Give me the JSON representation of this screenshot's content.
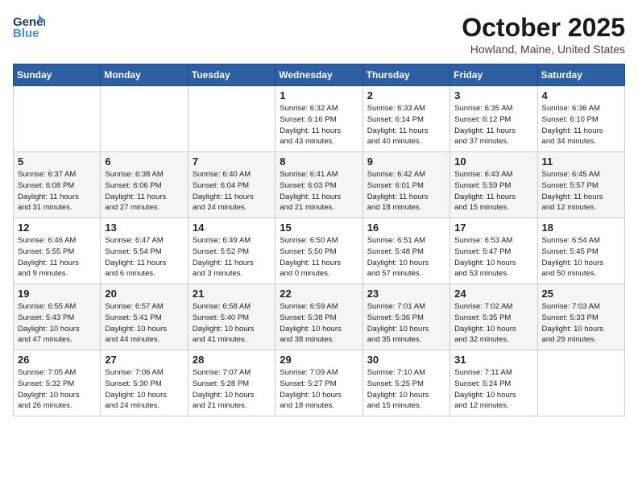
{
  "header": {
    "logo_line1": "General",
    "logo_line2": "Blue",
    "month": "October 2025",
    "location": "Howland, Maine, United States"
  },
  "days_of_week": [
    "Sunday",
    "Monday",
    "Tuesday",
    "Wednesday",
    "Thursday",
    "Friday",
    "Saturday"
  ],
  "weeks": [
    [
      {
        "day": "",
        "info": ""
      },
      {
        "day": "",
        "info": ""
      },
      {
        "day": "",
        "info": ""
      },
      {
        "day": "1",
        "info": "Sunrise: 6:32 AM\nSunset: 6:16 PM\nDaylight: 11 hours\nand 43 minutes."
      },
      {
        "day": "2",
        "info": "Sunrise: 6:33 AM\nSunset: 6:14 PM\nDaylight: 11 hours\nand 40 minutes."
      },
      {
        "day": "3",
        "info": "Sunrise: 6:35 AM\nSunset: 6:12 PM\nDaylight: 11 hours\nand 37 minutes."
      },
      {
        "day": "4",
        "info": "Sunrise: 6:36 AM\nSunset: 6:10 PM\nDaylight: 11 hours\nand 34 minutes."
      }
    ],
    [
      {
        "day": "5",
        "info": "Sunrise: 6:37 AM\nSunset: 6:08 PM\nDaylight: 11 hours\nand 31 minutes."
      },
      {
        "day": "6",
        "info": "Sunrise: 6:38 AM\nSunset: 6:06 PM\nDaylight: 11 hours\nand 27 minutes."
      },
      {
        "day": "7",
        "info": "Sunrise: 6:40 AM\nSunset: 6:04 PM\nDaylight: 11 hours\nand 24 minutes."
      },
      {
        "day": "8",
        "info": "Sunrise: 6:41 AM\nSunset: 6:03 PM\nDaylight: 11 hours\nand 21 minutes."
      },
      {
        "day": "9",
        "info": "Sunrise: 6:42 AM\nSunset: 6:01 PM\nDaylight: 11 hours\nand 18 minutes."
      },
      {
        "day": "10",
        "info": "Sunrise: 6:43 AM\nSunset: 5:59 PM\nDaylight: 11 hours\nand 15 minutes."
      },
      {
        "day": "11",
        "info": "Sunrise: 6:45 AM\nSunset: 5:57 PM\nDaylight: 11 hours\nand 12 minutes."
      }
    ],
    [
      {
        "day": "12",
        "info": "Sunrise: 6:46 AM\nSunset: 5:55 PM\nDaylight: 11 hours\nand 9 minutes."
      },
      {
        "day": "13",
        "info": "Sunrise: 6:47 AM\nSunset: 5:54 PM\nDaylight: 11 hours\nand 6 minutes."
      },
      {
        "day": "14",
        "info": "Sunrise: 6:49 AM\nSunset: 5:52 PM\nDaylight: 11 hours\nand 3 minutes."
      },
      {
        "day": "15",
        "info": "Sunrise: 6:50 AM\nSunset: 5:50 PM\nDaylight: 11 hours\nand 0 minutes."
      },
      {
        "day": "16",
        "info": "Sunrise: 6:51 AM\nSunset: 5:48 PM\nDaylight: 10 hours\nand 57 minutes."
      },
      {
        "day": "17",
        "info": "Sunrise: 6:53 AM\nSunset: 5:47 PM\nDaylight: 10 hours\nand 53 minutes."
      },
      {
        "day": "18",
        "info": "Sunrise: 6:54 AM\nSunset: 5:45 PM\nDaylight: 10 hours\nand 50 minutes."
      }
    ],
    [
      {
        "day": "19",
        "info": "Sunrise: 6:55 AM\nSunset: 5:43 PM\nDaylight: 10 hours\nand 47 minutes."
      },
      {
        "day": "20",
        "info": "Sunrise: 6:57 AM\nSunset: 5:41 PM\nDaylight: 10 hours\nand 44 minutes."
      },
      {
        "day": "21",
        "info": "Sunrise: 6:58 AM\nSunset: 5:40 PM\nDaylight: 10 hours\nand 41 minutes."
      },
      {
        "day": "22",
        "info": "Sunrise: 6:59 AM\nSunset: 5:38 PM\nDaylight: 10 hours\nand 38 minutes."
      },
      {
        "day": "23",
        "info": "Sunrise: 7:01 AM\nSunset: 5:36 PM\nDaylight: 10 hours\nand 35 minutes."
      },
      {
        "day": "24",
        "info": "Sunrise: 7:02 AM\nSunset: 5:35 PM\nDaylight: 10 hours\nand 32 minutes."
      },
      {
        "day": "25",
        "info": "Sunrise: 7:03 AM\nSunset: 5:33 PM\nDaylight: 10 hours\nand 29 minutes."
      }
    ],
    [
      {
        "day": "26",
        "info": "Sunrise: 7:05 AM\nSunset: 5:32 PM\nDaylight: 10 hours\nand 26 minutes."
      },
      {
        "day": "27",
        "info": "Sunrise: 7:06 AM\nSunset: 5:30 PM\nDaylight: 10 hours\nand 24 minutes."
      },
      {
        "day": "28",
        "info": "Sunrise: 7:07 AM\nSunset: 5:28 PM\nDaylight: 10 hours\nand 21 minutes."
      },
      {
        "day": "29",
        "info": "Sunrise: 7:09 AM\nSunset: 5:27 PM\nDaylight: 10 hours\nand 18 minutes."
      },
      {
        "day": "30",
        "info": "Sunrise: 7:10 AM\nSunset: 5:25 PM\nDaylight: 10 hours\nand 15 minutes."
      },
      {
        "day": "31",
        "info": "Sunrise: 7:11 AM\nSunset: 5:24 PM\nDaylight: 10 hours\nand 12 minutes."
      },
      {
        "day": "",
        "info": ""
      }
    ]
  ]
}
